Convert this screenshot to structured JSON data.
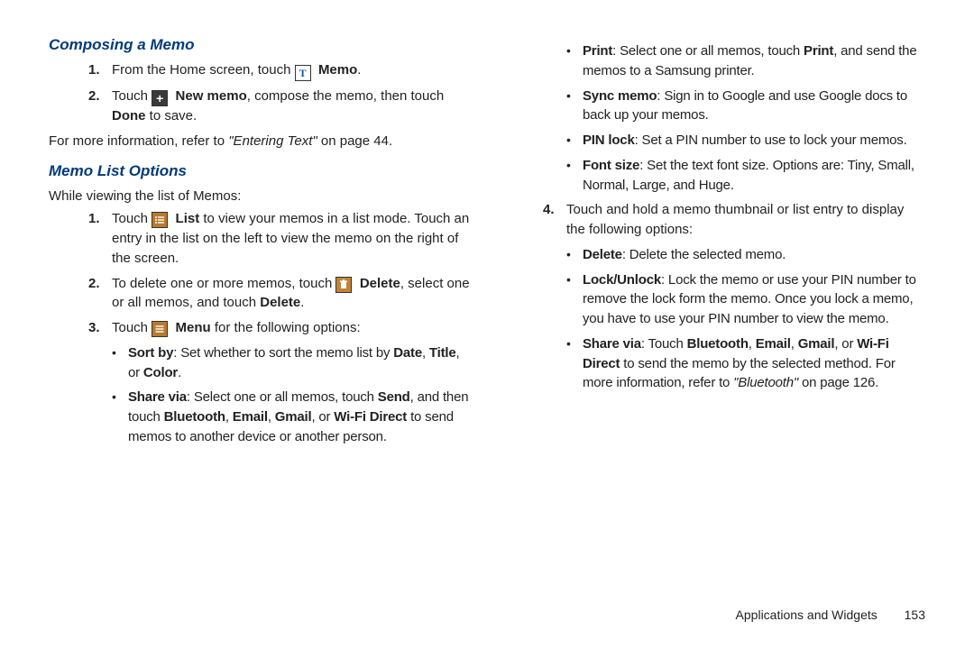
{
  "h1": "Composing a Memo",
  "c1": {
    "n1a": "1.",
    "n1b": "From the Home screen, touch ",
    "n1c": "Memo",
    "n1d": ".",
    "n2a": "2.",
    "n2b": "Touch ",
    "n2c": "New memo",
    "n2d": ", compose the memo, then touch ",
    "n2e": "Done",
    "n2f": " to save.",
    "p1a": "For more information, refer to ",
    "p1b": "\"Entering Text\"",
    "p1c": " on page 44."
  },
  "h2": "Memo List Options",
  "c2p": "While viewing the list of Memos:",
  "c2": {
    "n1a": "1.",
    "n1b": "Touch ",
    "n1c": "List",
    "n1d": " to view your memos in a list mode. Touch an entry in the list on the left to view the memo on the right of the screen.",
    "n2a": "2.",
    "n2b": "To delete one or more memos, touch ",
    "n2c": "Delete",
    "n2d": ", select one or all memos, and touch ",
    "n2e": "Delete",
    "n2f": ".",
    "n3a": "3.",
    "n3b": "Touch ",
    "n3c": "Menu",
    "n3d": " for the following options:",
    "b1a": "Sort by",
    "b1b": ": Set whether to sort the memo list by ",
    "b1c": "Date",
    "b1d": ", ",
    "b1e": "Title",
    "b1f": ", or ",
    "b1g": "Color",
    "b1h": ".",
    "b2a": "Share via",
    "b2b": ": Select one or all memos, touch ",
    "b2c": "Send",
    "b2d": ", and then touch ",
    "b2e": "Bluetooth",
    "b2f": ", ",
    "b2g": "Email",
    "b2h": ", ",
    "b2i": "Gmail",
    "b2j": ", or ",
    "b2k": "Wi-Fi Direct",
    "b2l": " to send memos to another device or another person."
  },
  "r": {
    "b3a": "Print",
    "b3b": ": Select one or all memos, touch ",
    "b3c": "Print",
    "b3d": ", and send the memos to a Samsung printer.",
    "b4a": "Sync memo",
    "b4b": ": Sign in to Google and use Google docs to back up your memos.",
    "b5a": "PIN lock",
    "b5b": ": Set a PIN number to use to lock your memos.",
    "b6a": "Font size",
    "b6b": ": Set the text font size. Options are: Tiny, Small, Normal, Large, and Huge.",
    "n4a": "4.",
    "n4b": "Touch and hold a memo thumbnail or list entry to display the following options:",
    "b7a": "Delete",
    "b7b": ": Delete the selected memo.",
    "b8a": "Lock/Unlock",
    "b8b": ": Lock the memo or use your PIN number to remove the lock form the memo. Once you lock a memo, you have to use your PIN number to view the memo.",
    "b9a": "Share via",
    "b9b": ": Touch ",
    "b9c": "Bluetooth",
    "b9d": ", ",
    "b9e": "Email",
    "b9f": ", ",
    "b9g": "Gmail",
    "b9h": ", or ",
    "b9i": "Wi-Fi Direct",
    "b9j": " to send the memo by the selected method. For more information, refer to ",
    "b9k": "\"Bluetooth\"",
    "b9l": " on page 126."
  },
  "footer": {
    "text": "Applications and Widgets",
    "page": "153"
  }
}
